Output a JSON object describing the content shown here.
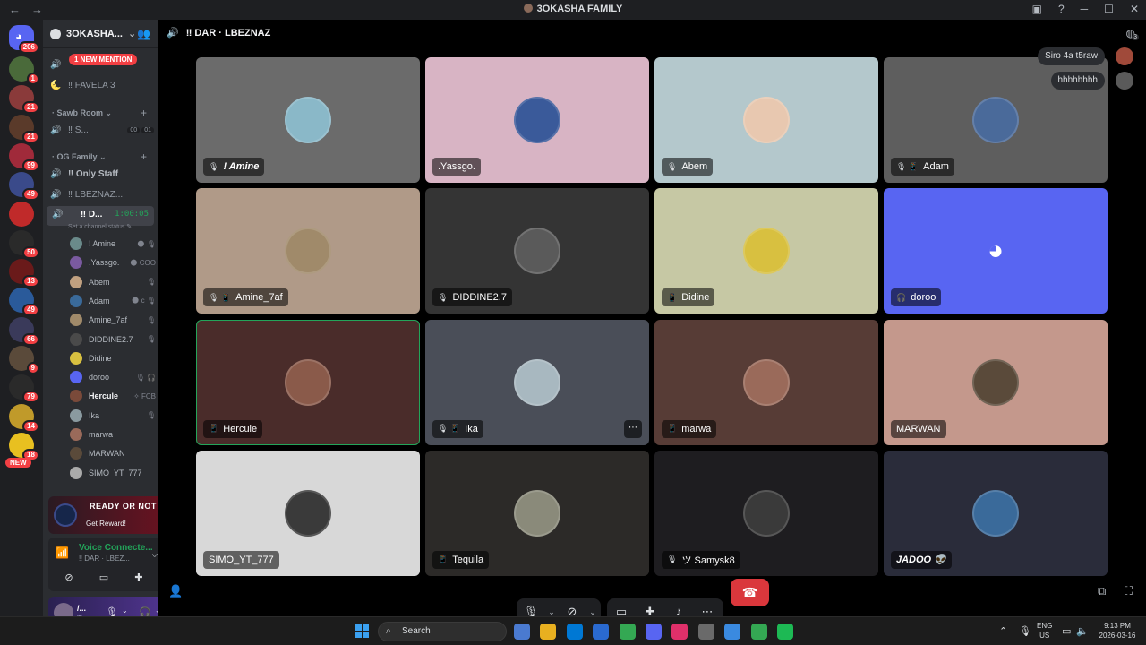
{
  "window": {
    "title": "3OKASHA FAMILY",
    "back_icon": "←",
    "forward_icon": "→"
  },
  "server_rail": {
    "home_badge": "206",
    "new_label": "NEW",
    "servers": [
      {
        "color": "#4a6a3a",
        "badge": "1"
      },
      {
        "color": "#8a3a3a",
        "badge": "21"
      },
      {
        "color": "#5a3a2a",
        "badge": "21"
      },
      {
        "color": "#a02a3a",
        "badge": "99"
      },
      {
        "color": "#3a4a8a",
        "badge": "49"
      },
      {
        "color": "#c02a2a",
        "badge": ""
      },
      {
        "color": "#2a2a2a",
        "badge": "50"
      },
      {
        "color": "#6a1a1a",
        "badge": "13"
      },
      {
        "color": "#2a5a9a",
        "badge": "49"
      },
      {
        "color": "#3a3a5a",
        "badge": "66"
      },
      {
        "color": "#5a4a3a",
        "badge": "9"
      },
      {
        "color": "#2a2a2a",
        "badge": "79"
      },
      {
        "color": "#c09a2a",
        "badge": "14"
      },
      {
        "color": "#e8c020",
        "badge": "18"
      }
    ]
  },
  "sidebar": {
    "guild_name": "3OKASHA...",
    "mention_pill": "1 NEW MENTION",
    "channels_top": [
      {
        "name": "",
        "icon": "🔊"
      },
      {
        "name": "‼ FAVELA 3",
        "icon": "🌜"
      }
    ],
    "cat_sawb": "Sawb Room",
    "chan_sawb": {
      "name": "‼ S...",
      "tag1": "00",
      "tag2": "01"
    },
    "cat_og": "OG Family",
    "chan_only_staff": "‼ Only Staff",
    "chan_lbeznaz": "‼ LBEZNAZ...",
    "active_channel": {
      "name": "‼ D...",
      "time": "1:00:05"
    },
    "channel_status": "Set a channel status ✎",
    "voice_users": [
      {
        "name": "! Amine",
        "color": "#6a8a8a",
        "status": "🌑 🎙",
        "bold": false
      },
      {
        "name": ".Yassgo.",
        "color": "#7a5aa0",
        "status": "🌑 COO",
        "bold": false
      },
      {
        "name": "Abem",
        "color": "#c0a080",
        "status": "🎙",
        "bold": false
      },
      {
        "name": "Adam",
        "color": "#3a6a9a",
        "status": "🌑 c 🎙",
        "bold": false
      },
      {
        "name": "Amine_7af",
        "color": "#a08a6a",
        "status": "🎙",
        "bold": false
      },
      {
        "name": "DIDDINE2.7",
        "color": "#4a4a4a",
        "status": "🎙",
        "bold": false
      },
      {
        "name": "Didine",
        "color": "#d8c040",
        "status": "",
        "bold": false
      },
      {
        "name": "doroo",
        "color": "#5865f2",
        "status": "🎙 🎧",
        "bold": false
      },
      {
        "name": "Hercule",
        "color": "#7a4a3a",
        "status": "✧ FCB",
        "bold": true
      },
      {
        "name": "Ika",
        "color": "#8a9aa0",
        "status": "🎙",
        "bold": false
      },
      {
        "name": "marwa",
        "color": "#9a6a5a",
        "status": "",
        "bold": false
      },
      {
        "name": "MARWAN",
        "color": "#5a4a3a",
        "status": "",
        "bold": false
      },
      {
        "name": "SIMO_YT_777",
        "color": "#aaaaaa",
        "status": "",
        "bold": false
      }
    ]
  },
  "promo": {
    "title": "READY OR NOT",
    "cta": "Get Reward!"
  },
  "voice_panel": {
    "status": "Voice Connecte...",
    "channel": "‼ DAR · LBEZ..."
  },
  "user_panel": {
    "name": "/...",
    "status": "In"
  },
  "main": {
    "channel_title": "‼ DAR · LBEZNAZ",
    "notif_count": "3"
  },
  "tiles": [
    {
      "name": "! Amine",
      "bg": "#6b6b6b",
      "avatar": "#8ab8c8",
      "icons": "🎙",
      "bold": true,
      "speaking": false
    },
    {
      "name": ".Yassgo.",
      "bg": "#d8b4c4",
      "avatar": "#3a5a9a",
      "icons": "",
      "bold": false,
      "speaking": false
    },
    {
      "name": "Abem",
      "bg": "#b4c8cc",
      "avatar": "#e8c8b0",
      "icons": "🎙",
      "bold": false,
      "speaking": false
    },
    {
      "name": "Adam",
      "bg": "#5e5e5e",
      "avatar": "#4a6a9a",
      "icons": "🎙 📱",
      "bold": false,
      "speaking": false
    },
    {
      "name": "Amine_7af",
      "bg": "#b09a88",
      "avatar": "#a08a6a",
      "icons": "🎙 📱",
      "bold": false,
      "speaking": false
    },
    {
      "name": "DIDDINE2.7",
      "bg": "#343434",
      "avatar": "#5a5a5a",
      "icons": "🎙",
      "bold": false,
      "speaking": false
    },
    {
      "name": "Didine",
      "bg": "#c6c8a4",
      "avatar": "#d8c040",
      "icons": "📱",
      "bold": false,
      "speaking": false
    },
    {
      "name": "doroo",
      "bg": "#5865f2",
      "avatar": "#5865f2",
      "icons": "🎧",
      "bold": false,
      "speaking": false,
      "discord": true
    },
    {
      "name": "Hercule",
      "bg": "#4a2c2a",
      "avatar": "#8a5a4a",
      "icons": "📱",
      "bold": false,
      "speaking": true
    },
    {
      "name": "Ika",
      "bg": "#4a4e58",
      "avatar": "#a8b8c0",
      "icons": "🎙 📱",
      "bold": false,
      "speaking": false,
      "more": true
    },
    {
      "name": "marwa",
      "bg": "#573c36",
      "avatar": "#9a6a5a",
      "icons": "📱",
      "bold": false,
      "speaking": false
    },
    {
      "name": "MARWAN",
      "bg": "#c4988c",
      "avatar": "#5a4a3a",
      "icons": "",
      "bold": false,
      "speaking": false
    },
    {
      "name": "SIMO_YT_777",
      "bg": "#d8d8d8",
      "avatar": "#3a3a3a",
      "icons": "",
      "bold": false,
      "speaking": false
    },
    {
      "name": "Tequila",
      "bg": "#2c2a28",
      "avatar": "#8a8a7a",
      "icons": "📱",
      "bold": false,
      "speaking": false
    },
    {
      "name": "ツ Samysk8",
      "bg": "#1e1d20",
      "avatar": "#3a3a3a",
      "icons": "🎙",
      "bold": false,
      "speaking": false
    },
    {
      "name": "JADOO 👽",
      "bg": "#2a2c3a",
      "avatar": "#3a6a9a",
      "icons": "",
      "bold": true,
      "speaking": false
    }
  ],
  "chat": [
    {
      "text": "Siro 4a t5raw",
      "avatar": "#a04a3a"
    },
    {
      "text": "hhhhhhhh",
      "avatar": "#5a5a5a"
    }
  ],
  "taskbar": {
    "search_placeholder": "Search",
    "lang_top": "ENG",
    "lang_bottom": "US",
    "time": "9:13 PM",
    "date": "2026-03-16",
    "apps": [
      "#4a7ad0",
      "#e8b020",
      "#0078d4",
      "#2a6ad0",
      "#34a853",
      "#5865f2",
      "#e0306a",
      "#6a6a6a",
      "#3a8ae0",
      "#34a853",
      "#1db954"
    ]
  }
}
